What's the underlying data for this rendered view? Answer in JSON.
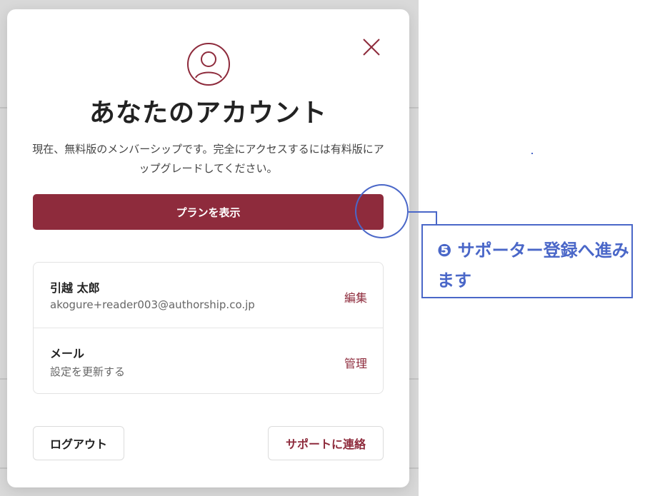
{
  "modal": {
    "title": "あなたのアカウント",
    "description": "現在、無料版のメンバーシップです。完全にアクセスするには有料版にアップグレードしてください。",
    "plan_button": "プランを表示",
    "profile": {
      "name": "引越 太郎",
      "email": "akogure+reader003@authorship.co.jp",
      "action": "編集"
    },
    "mail": {
      "title": "メール",
      "subtitle": "設定を更新する",
      "action": "管理"
    },
    "logout_button": "ログアウト",
    "support_button": "サポートに連絡"
  },
  "annotation": {
    "text": "❺ サポーター登録へ進みます"
  },
  "icons": {
    "close": "close-icon",
    "avatar": "user-avatar-icon"
  },
  "colors": {
    "accent": "#8e2b3c",
    "annotation": "#4a67c8",
    "backdrop": "#d9d9d9"
  }
}
